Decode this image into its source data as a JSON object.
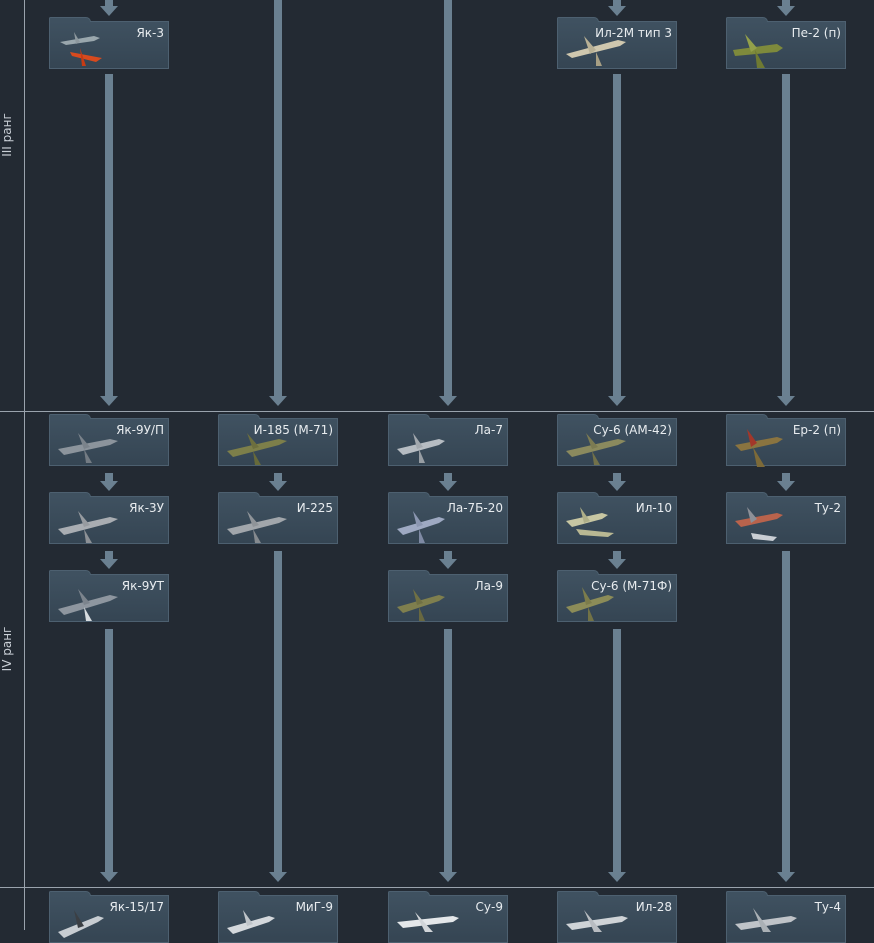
{
  "ranks": {
    "iii": {
      "label": "III ранг"
    },
    "iv": {
      "label": "IV ранг"
    }
  },
  "colors": {
    "background": "#232a33",
    "card": "#3f5160",
    "arrow": "#6a8091",
    "separator": "#9aa3ad"
  },
  "vehicles": {
    "yak_3": {
      "label": "Як-3",
      "icon": "fighter-plane-icon"
    },
    "il_2m_3": {
      "label": "Ил-2М тип 3",
      "icon": "attacker-plane-icon"
    },
    "pe_2_p": {
      "label": "Пе-2 (п)",
      "icon": "bomber-plane-icon"
    },
    "yak_9u_p": {
      "label": "Як-9У/П",
      "icon": "fighter-plane-icon"
    },
    "i_185_m71": {
      "label": "И-185 (М-71)",
      "icon": "fighter-plane-icon"
    },
    "la_7": {
      "label": "Ла-7",
      "icon": "fighter-plane-icon"
    },
    "su_6_am42": {
      "label": "Су-6 (АМ-42)",
      "icon": "attacker-plane-icon"
    },
    "er_2_p": {
      "label": "Ер-2 (п)",
      "icon": "bomber-plane-icon"
    },
    "yak_3u": {
      "label": "Як-3У",
      "icon": "fighter-plane-icon"
    },
    "i_225": {
      "label": "И-225",
      "icon": "fighter-plane-icon"
    },
    "la_7b_20": {
      "label": "Ла-7Б-20",
      "icon": "fighter-plane-icon"
    },
    "il_10": {
      "label": "Ил-10",
      "icon": "attacker-plane-icon"
    },
    "tu_2": {
      "label": "Ту-2",
      "icon": "bomber-plane-icon"
    },
    "yak_9ut": {
      "label": "Як-9УТ",
      "icon": "fighter-plane-icon"
    },
    "la_9": {
      "label": "Ла-9",
      "icon": "fighter-plane-icon"
    },
    "su_6_m71f": {
      "label": "Су-6 (М-71Ф)",
      "icon": "attacker-plane-icon"
    },
    "yak_15_17": {
      "label": "Як-15/17",
      "icon": "jet-plane-icon"
    },
    "mig_9": {
      "label": "МиГ-9",
      "icon": "jet-plane-icon"
    },
    "su_9": {
      "label": "Су-9",
      "icon": "jet-plane-icon"
    },
    "il_28": {
      "label": "Ил-28",
      "icon": "jet-bomber-icon"
    },
    "tu_4": {
      "label": "Ту-4",
      "icon": "bomber-plane-icon"
    }
  }
}
